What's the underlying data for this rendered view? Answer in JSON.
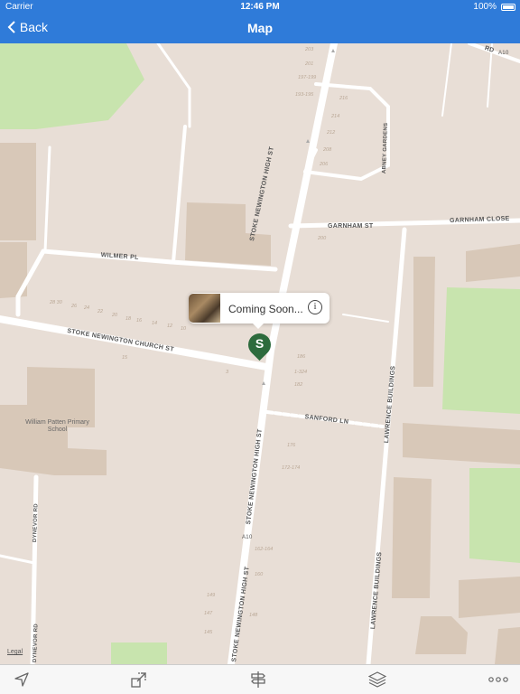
{
  "status": {
    "carrier": "Carrier",
    "time": "12:46 PM",
    "battery": "100%"
  },
  "navbar": {
    "back_label": "Back",
    "title": "Map"
  },
  "streets": {
    "stoke_high_1": "STOKE NEWINGTON HIGH ST",
    "stoke_high_2": "STOKE NEWINGTON HIGH ST",
    "church_st": "STOKE NEWINGTON CHURCH ST",
    "wilmer": "WILMER PL",
    "garnham": "GARNHAM ST",
    "garnham_close": "GARNHAM CLOSE",
    "sanford": "SANFORD LN",
    "lawrence_1": "LAWRENCE BUILDINGS",
    "lawrence_2": "LAWRENCE BUILDINGS",
    "abney": "ABNEY GARDENS",
    "dynevor_1": "DYNEVOR RD",
    "dynevor_2": "DYNEVOR RD",
    "a10_top": "A10",
    "a10_mid": "A10",
    "rd_top": "RD"
  },
  "house_numbers": [
    "203",
    "201",
    "197-199",
    "193-195",
    "216",
    "214",
    "212",
    "208",
    "206",
    "200",
    "28 30",
    "26",
    "24",
    "22",
    "20",
    "18",
    "16",
    "14",
    "12",
    "10",
    "15",
    "3",
    "186",
    "1-324",
    "182",
    "176",
    "172-174",
    "162-164",
    "160",
    "149",
    "147",
    "148",
    "145"
  ],
  "poi": {
    "school": "William Patten Primary School"
  },
  "callout": {
    "title": "Coming Soon...",
    "info_icon": "i"
  },
  "marker": {
    "letter": "S",
    "color": "#2d6b3d"
  },
  "map": {
    "legal": "Legal"
  },
  "colors": {
    "accent": "#2f7bd9",
    "park": "#c8e4ae",
    "building": "#d8c8b8",
    "road": "#ffffff"
  }
}
